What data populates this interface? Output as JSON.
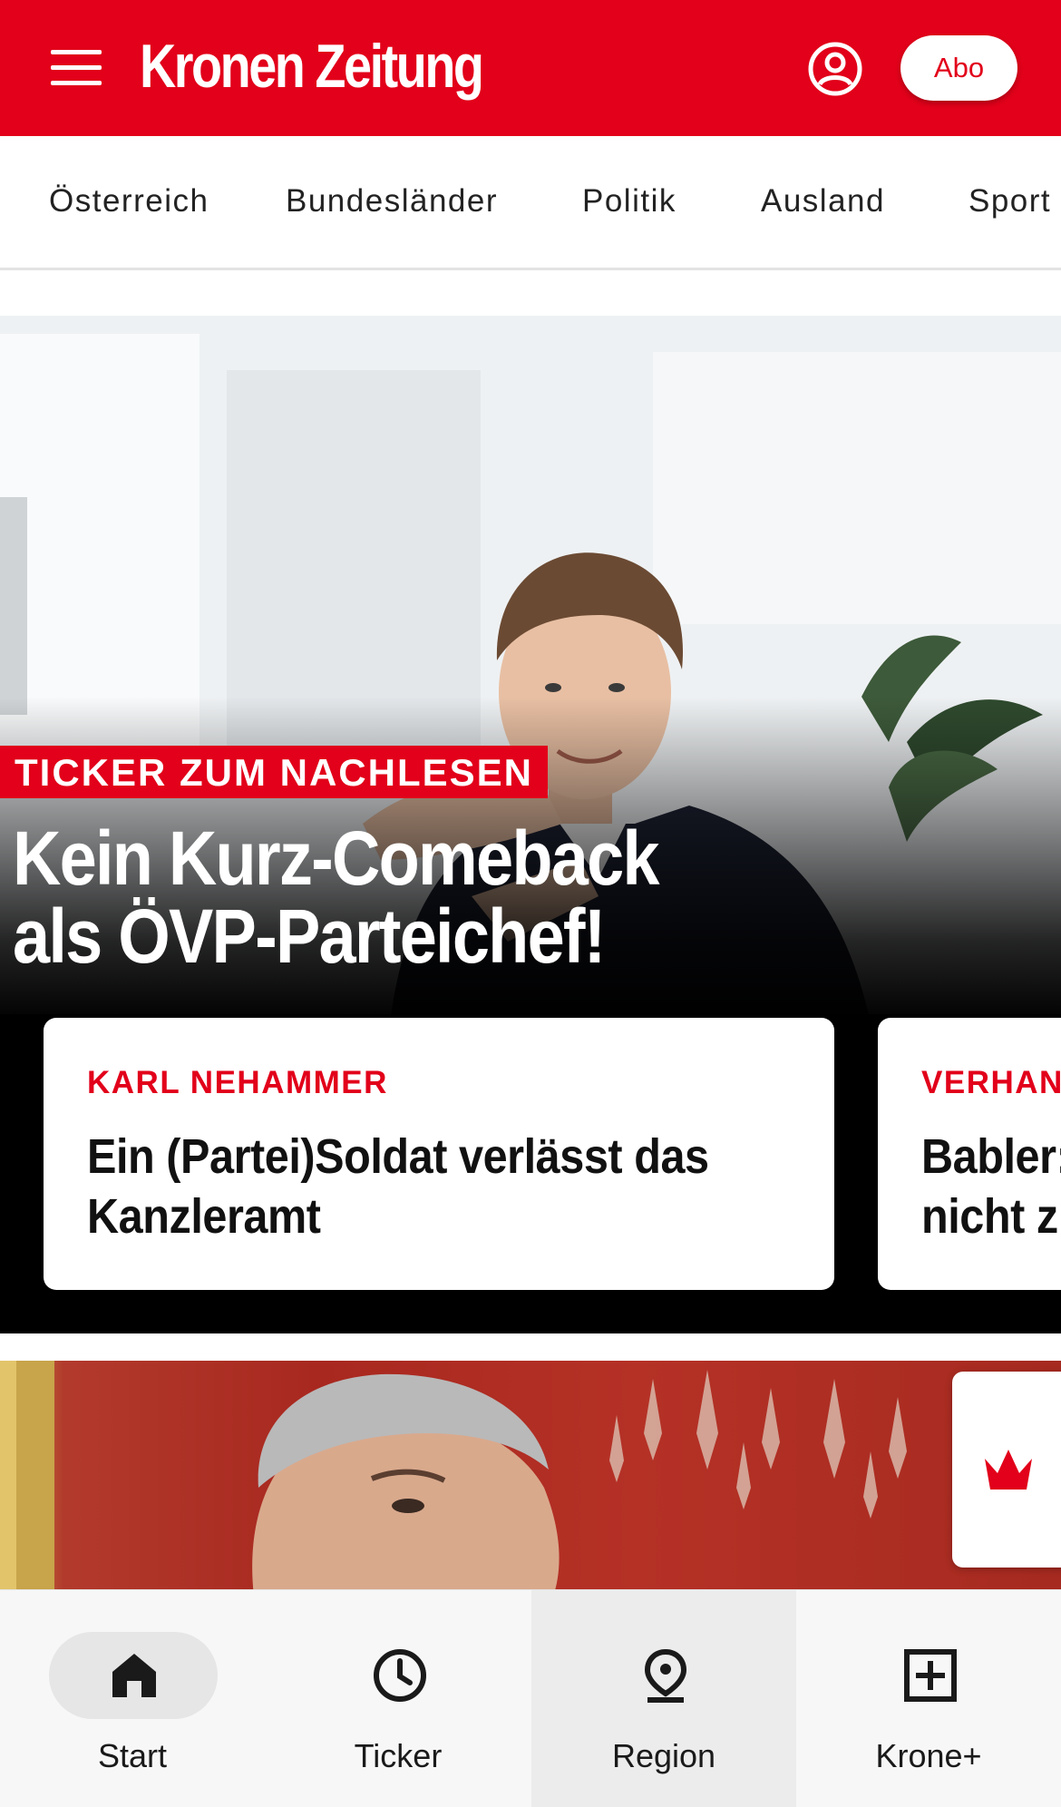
{
  "header": {
    "logo": "Kronen Zeitung",
    "abo_label": "Abo",
    "brand_color": "#e2001a",
    "menu_icon": "hamburger-menu-icon",
    "account_icon": "user-account-icon"
  },
  "categories": [
    "Österreich",
    "Bundesländer",
    "Politik",
    "Ausland",
    "Sport"
  ],
  "hero": {
    "kicker": "TICKER ZUM NACHLESEN",
    "title_line1": "Kein Kurz-Comeback",
    "title_line2": "als ÖVP-Parteichef!"
  },
  "cards": [
    {
      "kicker": "KARL NEHAMMER",
      "title_line1": "Ein (Partei)Soldat verlässt das",
      "title_line2": "Kanzleramt"
    },
    {
      "kicker": "VERHANDLUNGEN",
      "title_line1": "Babler:",
      "title_line2": "nicht z"
    }
  ],
  "krone_tab_icon": "crown-icon",
  "tabbar": {
    "items": [
      {
        "label": "Start",
        "icon": "home-icon",
        "active": true
      },
      {
        "label": "Ticker",
        "icon": "clock-icon"
      },
      {
        "label": "Region",
        "icon": "location-pin-icon"
      },
      {
        "label": "Krone+",
        "icon": "plus-box-icon"
      }
    ]
  }
}
